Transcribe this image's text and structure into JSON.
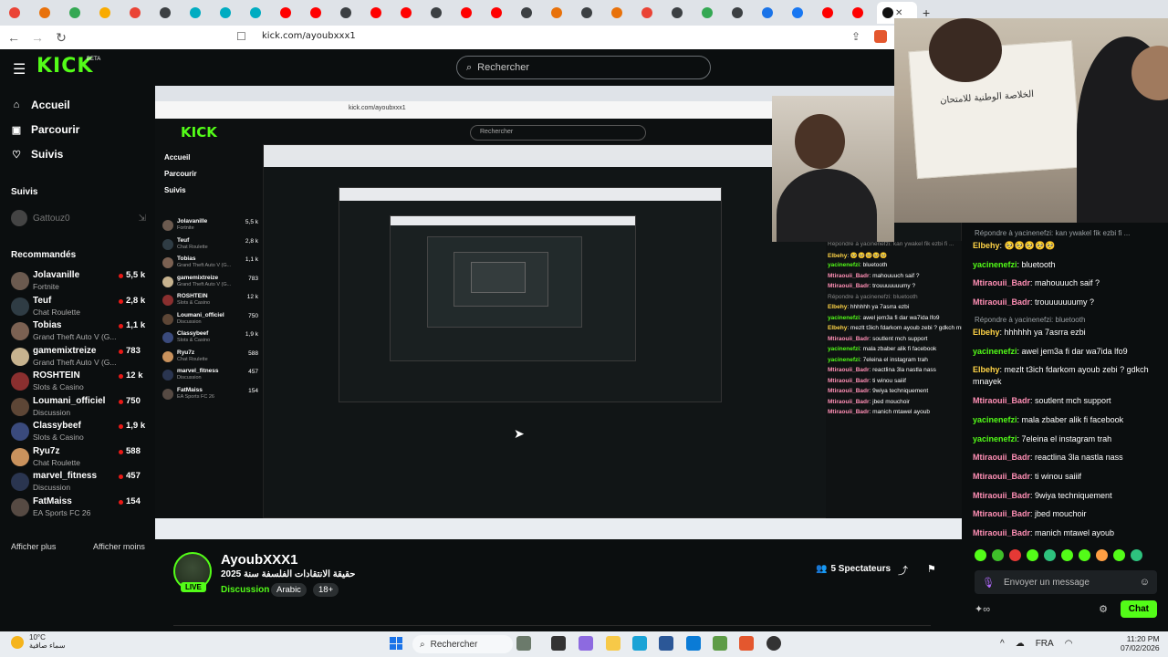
{
  "browser": {
    "url": "kick.com/ayoubxxx1",
    "active_tab_label": "",
    "tab_favicon_colors": [
      "#ea4335",
      "#e8710a",
      "#34a853",
      "#f9ab00",
      "#ea4335",
      "#3c4043",
      "#00acc1",
      "#00acc1",
      "#00acc1",
      "#ff0000",
      "#ff0000",
      "#3c4043",
      "#ff0000",
      "#ff0000",
      "#3c4043",
      "#ff0000",
      "#ff0000",
      "#3c4043",
      "#e8710a",
      "#3c4043",
      "#e8710a",
      "#ea4335",
      "#3c4043",
      "#34a853",
      "#3c4043",
      "#1a73e8",
      "#1877f2",
      "#ff0000",
      "#ff0000"
    ]
  },
  "kick": {
    "logo": "KICK",
    "beta": "BETA",
    "search_placeholder": "Rechercher",
    "nav": [
      {
        "label": "Accueil",
        "icon": "home-icon"
      },
      {
        "label": "Parcourir",
        "icon": "browse-icon"
      },
      {
        "label": "Suivis",
        "icon": "heart-icon"
      }
    ],
    "followed_title": "Suivis",
    "followed_user": "Gattouz0",
    "recommended_title": "Recommandés",
    "recommended": [
      {
        "name": "Jolavanille",
        "category": "Fortnite",
        "viewers": "5,5 k",
        "color": "#6b5a4f"
      },
      {
        "name": "Teuf",
        "category": "Chat Roulette",
        "viewers": "2,8 k",
        "color": "#2f3c44"
      },
      {
        "name": "Tobias",
        "category": "Grand Theft Auto V (G...",
        "viewers": "1,1 k",
        "color": "#7b6152"
      },
      {
        "name": "gamemixtreize",
        "category": "Grand Theft Auto V (G...",
        "viewers": "783",
        "color": "#c7b38f"
      },
      {
        "name": "ROSHTEIN",
        "category": "Slots & Casino",
        "viewers": "12 k",
        "color": "#8a2f2f"
      },
      {
        "name": "Loumani_officiel",
        "category": "Discussion",
        "viewers": "750",
        "color": "#5d4636"
      },
      {
        "name": "Classybeef",
        "category": "Slots & Casino",
        "viewers": "1,9 k",
        "color": "#3a4a7c"
      },
      {
        "name": "Ryu7z",
        "category": "Chat Roulette",
        "viewers": "588",
        "color": "#c9925d"
      },
      {
        "name": "marvel_fitness",
        "category": "Discussion",
        "viewers": "457",
        "color": "#2a3550"
      },
      {
        "name": "FatMaiss",
        "category": "EA Sports FC 26",
        "viewers": "154",
        "color": "#564a43"
      }
    ],
    "show_more": "Afficher plus",
    "show_less": "Afficher moins"
  },
  "stream": {
    "streamer": "AyoubXXX1",
    "title": "2025 حقيقة الانتقادات الفلسفة سنة",
    "category": "Discussion",
    "tags": [
      "Arabic",
      "18+"
    ],
    "live_label": "LIVE",
    "viewers": "5 Spectateurs"
  },
  "webcam": {
    "certificate_text": "الخلاصة الوطنية للامتحان"
  },
  "chat": {
    "messages": [
      {
        "type": "reply",
        "text": "Répondre à yacinenefzi: kan ywakel fik ezbi fi ..."
      },
      {
        "user": "Elbehy",
        "color": "#ffd447",
        "text": ": 🥺🥺🥺🥺🥺"
      },
      {
        "user": "yacinenefzi",
        "color": "#53fc18",
        "text": ": bluetooth"
      },
      {
        "user": "Mtiraouii_Badr",
        "color": "#ff8fb5",
        "text": ": mahouuuch saif ?"
      },
      {
        "user": "Mtiraouii_Badr",
        "color": "#ff8fb5",
        "text": ": trouuuuuuumy ?"
      },
      {
        "type": "reply",
        "text": "Répondre à yacinenefzi: bluetooth"
      },
      {
        "user": "Elbehy",
        "color": "#ffd447",
        "text": ": hhhhhh ya 7asrra ezbi"
      },
      {
        "user": "yacinenefzi",
        "color": "#53fc18",
        "text": ": awel jem3a fi dar wa7ida lfo9"
      },
      {
        "user": "Elbehy",
        "color": "#ffd447",
        "text": ": mezlt t3ich fdarkom ayoub zebi ? gdkch mnayek"
      },
      {
        "user": "Mtiraouii_Badr",
        "color": "#ff8fb5",
        "text": ": soutlent mch support"
      },
      {
        "user": "yacinenefzi",
        "color": "#53fc18",
        "text": ": mala zbaber alik fi facebook"
      },
      {
        "user": "yacinenefzi",
        "color": "#53fc18",
        "text": ": 7eleina el instagram trah"
      },
      {
        "user": "Mtiraouii_Badr",
        "color": "#ff8fb5",
        "text": ": reactlina 3la nastla nass"
      },
      {
        "user": "Mtiraouii_Badr",
        "color": "#ff8fb5",
        "text": ": ti winou saiiif"
      },
      {
        "user": "Mtiraouii_Badr",
        "color": "#ff8fb5",
        "text": ": 9wiya techniquement"
      },
      {
        "user": "Mtiraouii_Badr",
        "color": "#ff8fb5",
        "text": ": jbed mouchoir"
      },
      {
        "user": "Mtiraouii_Badr",
        "color": "#ff8fb5",
        "text": ": manich mtawel ayoub"
      }
    ],
    "input_placeholder": "Envoyer un message",
    "send_label": "Chat"
  },
  "taskbar": {
    "weather_temp": "10°C",
    "weather_desc": "سماء صافية",
    "search": "Rechercher",
    "lang": "FRA",
    "time": "11:20 PM",
    "date": "07/02/2026"
  }
}
